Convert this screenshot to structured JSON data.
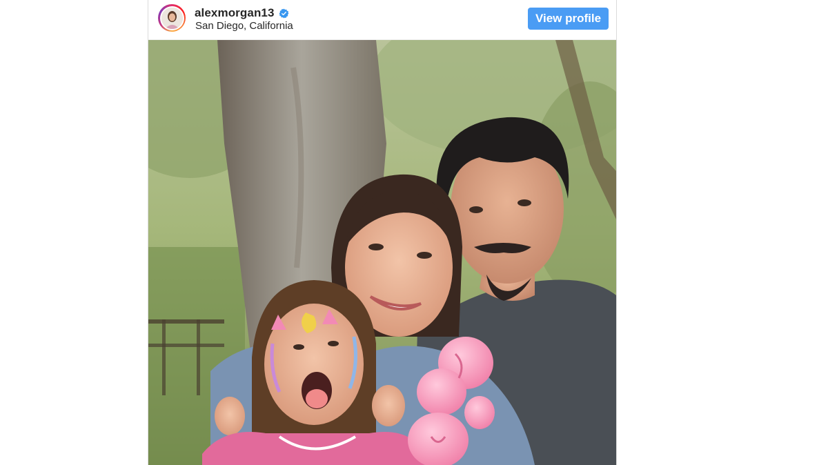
{
  "post": {
    "username": "alexmorgan13",
    "location": "San Diego, California",
    "view_profile_label": "View profile"
  },
  "icons": {
    "verified": "verified-badge-icon",
    "avatar": "profile-avatar"
  },
  "colors": {
    "button_bg": "#4a9cf4",
    "verified_blue": "#3897f0",
    "text": "#262626"
  }
}
